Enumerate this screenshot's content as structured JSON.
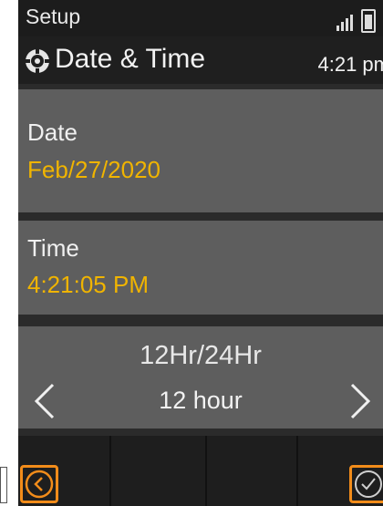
{
  "statusbar": {
    "title": "Setup",
    "icons": [
      "signal-icon",
      "battery-icon"
    ]
  },
  "header": {
    "title": "Date & Time",
    "time": "4:21 pm",
    "icon": "gear-icon"
  },
  "fields": {
    "date": {
      "label": "Date",
      "value": "Feb/27/2020"
    },
    "time": {
      "label": "Time",
      "value": "4:21:05 PM"
    }
  },
  "selector": {
    "caption": "12Hr/24Hr",
    "value": "12 hour",
    "prev_icon": "chevron-left-icon",
    "next_icon": "chevron-right-icon"
  },
  "bottom_bar": {
    "back_icon": "back-icon",
    "confirm_icon": "checkmark-icon"
  },
  "colors": {
    "accent": "#f0b400",
    "highlight_border": "#f28c1a",
    "panel": "#5e5e5e",
    "background": "#2b2b2b"
  }
}
